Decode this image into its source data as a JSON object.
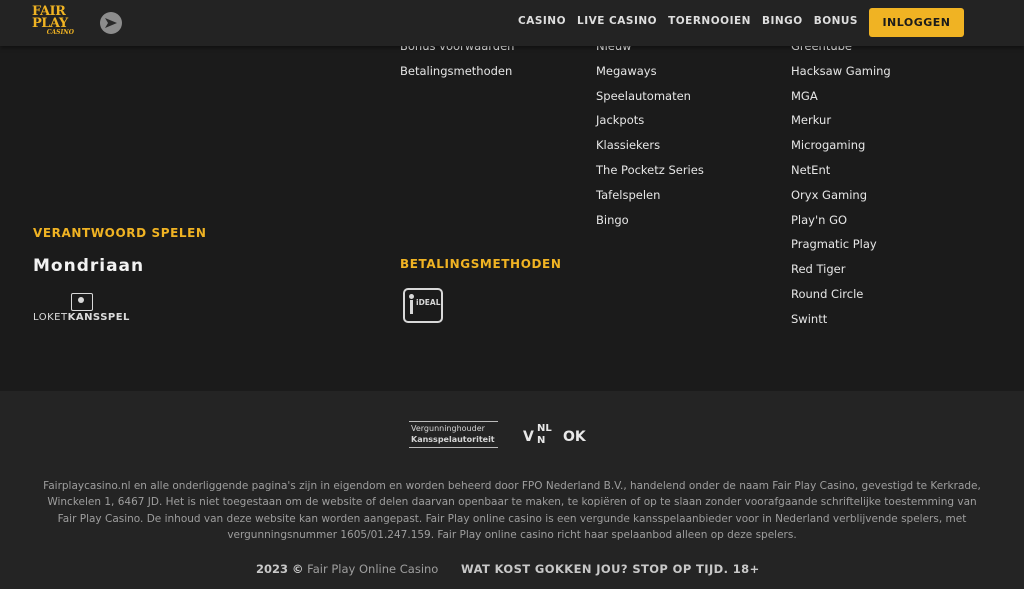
{
  "header": {
    "logo": {
      "line1": "FAIR",
      "line2": "PLAY",
      "line3": "CASINO"
    },
    "nav": [
      "CASINO",
      "LIVE CASINO",
      "TOERNOOIEN",
      "BINGO",
      "BONUS"
    ],
    "login_label": "INLOGGEN"
  },
  "columns": {
    "info": [
      "Bonus voorwaarden",
      "Betalingsmethoden"
    ],
    "games": [
      "Nieuw",
      "Megaways",
      "Speelautomaten",
      "Jackpots",
      "Klassiekers",
      "The Pocketz Series",
      "Tafelspelen",
      "Bingo"
    ],
    "providers": [
      "Greentube",
      "Hacksaw Gaming",
      "MGA",
      "Merkur",
      "Microgaming",
      "NetEnt",
      "Oryx Gaming",
      "Play'n GO",
      "Pragmatic Play",
      "Red Tiger",
      "Round Circle",
      "Swintt"
    ]
  },
  "responsible": {
    "title": "VERANTWOORD SPELEN",
    "mondriaan": "Mondriaan",
    "loket_part1": "LOKET",
    "loket_part2": "KANSSPEL"
  },
  "payments": {
    "title": "BETALINGSMETHODEN",
    "ideal_label": "iDEAL"
  },
  "footer": {
    "ksa_line1": "Vergunninghouder",
    "ksa_line2": "Kansspelautoriteit",
    "vnlok": {
      "v": "V",
      "n1": "NL",
      "n2": "N",
      "ok": "OK"
    },
    "disclaimer": "Fairplaycasino.nl en alle onderliggende pagina's zijn in eigendom en worden beheerd door FPO Nederland B.V., handelend onder de naam Fair Play Casino, gevestigd te Kerkrade, Winckelen 1, 6467 JD. Het is niet toegestaan om de website of delen daarvan openbaar te maken, te kopiëren of op te slaan zonder voorafgaande schriftelijke toestemming van Fair Play Casino. De inhoud van deze website kan worden aangepast. Fair Play online casino is een vergunde kansspelaanbieder voor in Nederland verblijvende spelers, met vergunningsnummer 1605/01.247.159. Fair Play online casino richt haar spelaanbod alleen op deze spelers.",
    "year": "2023 ©",
    "company": "Fair Play Online Casino",
    "slogan": "WAT KOST GOKKEN JOU? STOP OP TIJD. 18+"
  }
}
